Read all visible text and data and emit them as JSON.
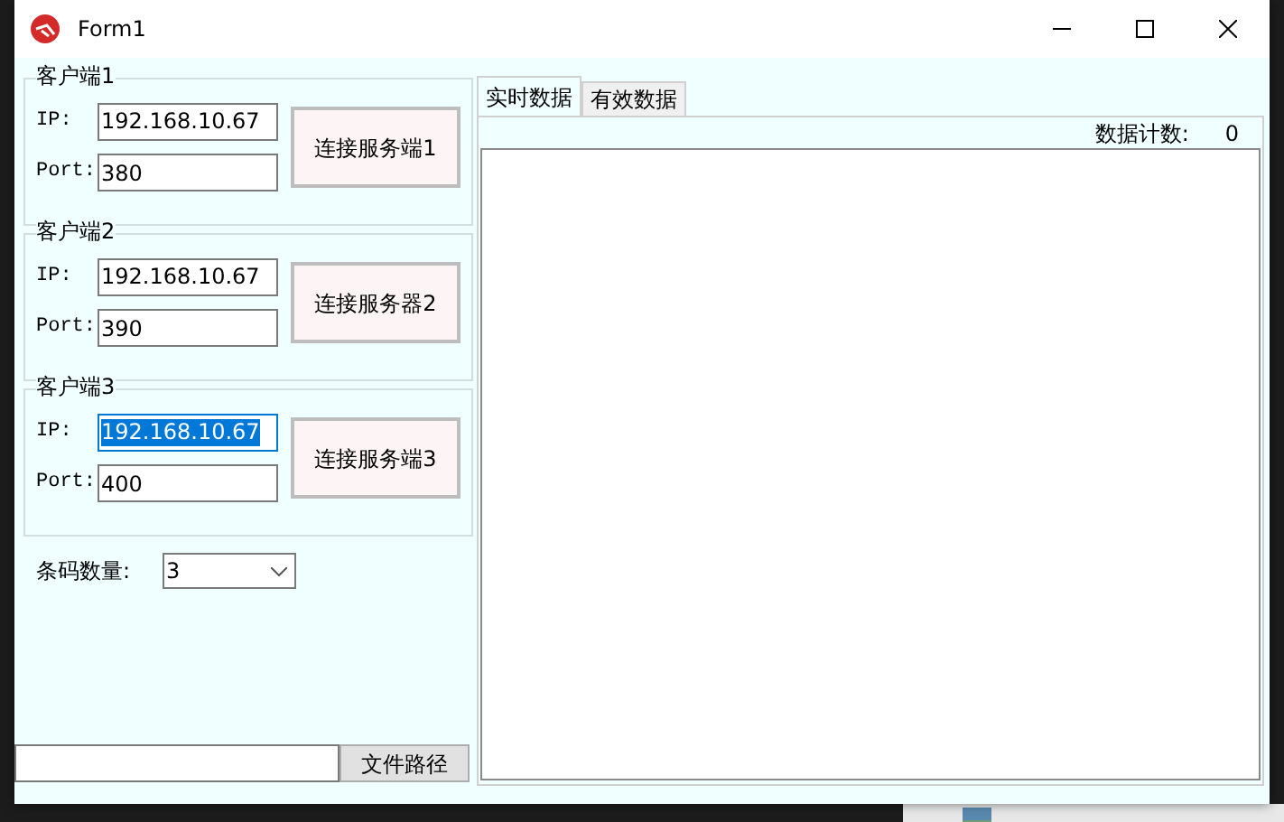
{
  "window": {
    "title": "Form1"
  },
  "clients": [
    {
      "title": "客户端1",
      "ip_label": "IP:",
      "ip": "192.168.10.67",
      "ip_selected": false,
      "port_label": "Port:",
      "port": "380",
      "button": "连接服务端1"
    },
    {
      "title": "客户端2",
      "ip_label": "IP:",
      "ip": "192.168.10.67",
      "ip_selected": false,
      "port_label": "Port:",
      "port": "390",
      "button": "连接服务器2"
    },
    {
      "title": "客户端3",
      "ip_label": "IP:",
      "ip": "192.168.10.67",
      "ip_selected": true,
      "port_label": "Port:",
      "port": "400",
      "button": "连接服务端3"
    }
  ],
  "barcode_count": {
    "label": "条码数量:",
    "value": "3"
  },
  "file": {
    "button": "文件路径"
  },
  "tabs": [
    {
      "label": "实时数据",
      "selected": true
    },
    {
      "label": "有效数据",
      "selected": false
    }
  ],
  "data_count": {
    "label": "数据计数:",
    "value": "0"
  }
}
